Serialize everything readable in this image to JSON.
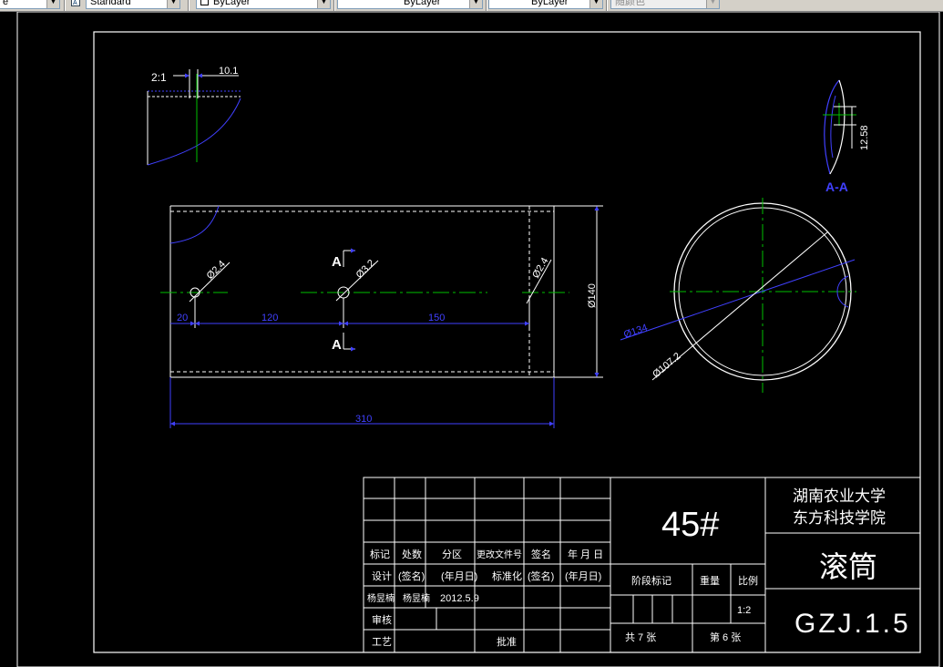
{
  "toolbar": {
    "first_value": "e",
    "textstyle_value": "Standard",
    "layer_value": "ByLayer",
    "linetype_value": "ByLayer",
    "lineweight_value": "ByLayer",
    "color_value": "随颜色"
  },
  "detail": {
    "scale": "2:1",
    "dim": "10.1"
  },
  "section": {
    "label": "A-A",
    "dim": "12.58"
  },
  "front": {
    "dia_left": "Ø2.4",
    "dia_mid": "Ø3.2",
    "dia_right": "Ø2.4",
    "height": "Ø140",
    "dim_20": "20",
    "dim_120": "120",
    "dim_150": "150",
    "length": "310",
    "section_top": "A",
    "section_bottom": "A"
  },
  "circle": {
    "dia_outer": "Ø134",
    "dia_inner": "Ø107.2"
  },
  "title_block": {
    "header_labels": [
      "标记",
      "处数",
      "分区",
      "更改文件号",
      "签名",
      "年 月 日"
    ],
    "design_labels": [
      "设计",
      "(签名)",
      "(年月日)",
      "标准化",
      "(签名)",
      "(年月日)"
    ],
    "designer_row": [
      "杨昱楠",
      "杨昱楠",
      "2012.5.9"
    ],
    "review": "审核",
    "process": "工艺",
    "approve": "批准",
    "material": "45#",
    "stage_mark": "阶段标记",
    "weight": "重量",
    "ratio_label": "比例",
    "ratio": "1:2",
    "total_sheets": "共 7 张",
    "sheet_no": "第 6 张",
    "school_line1": "湖南农业大学",
    "school_line2": "东方科技学院",
    "part_name": "滚筒",
    "drawing_no": "GZJ.1.5"
  }
}
